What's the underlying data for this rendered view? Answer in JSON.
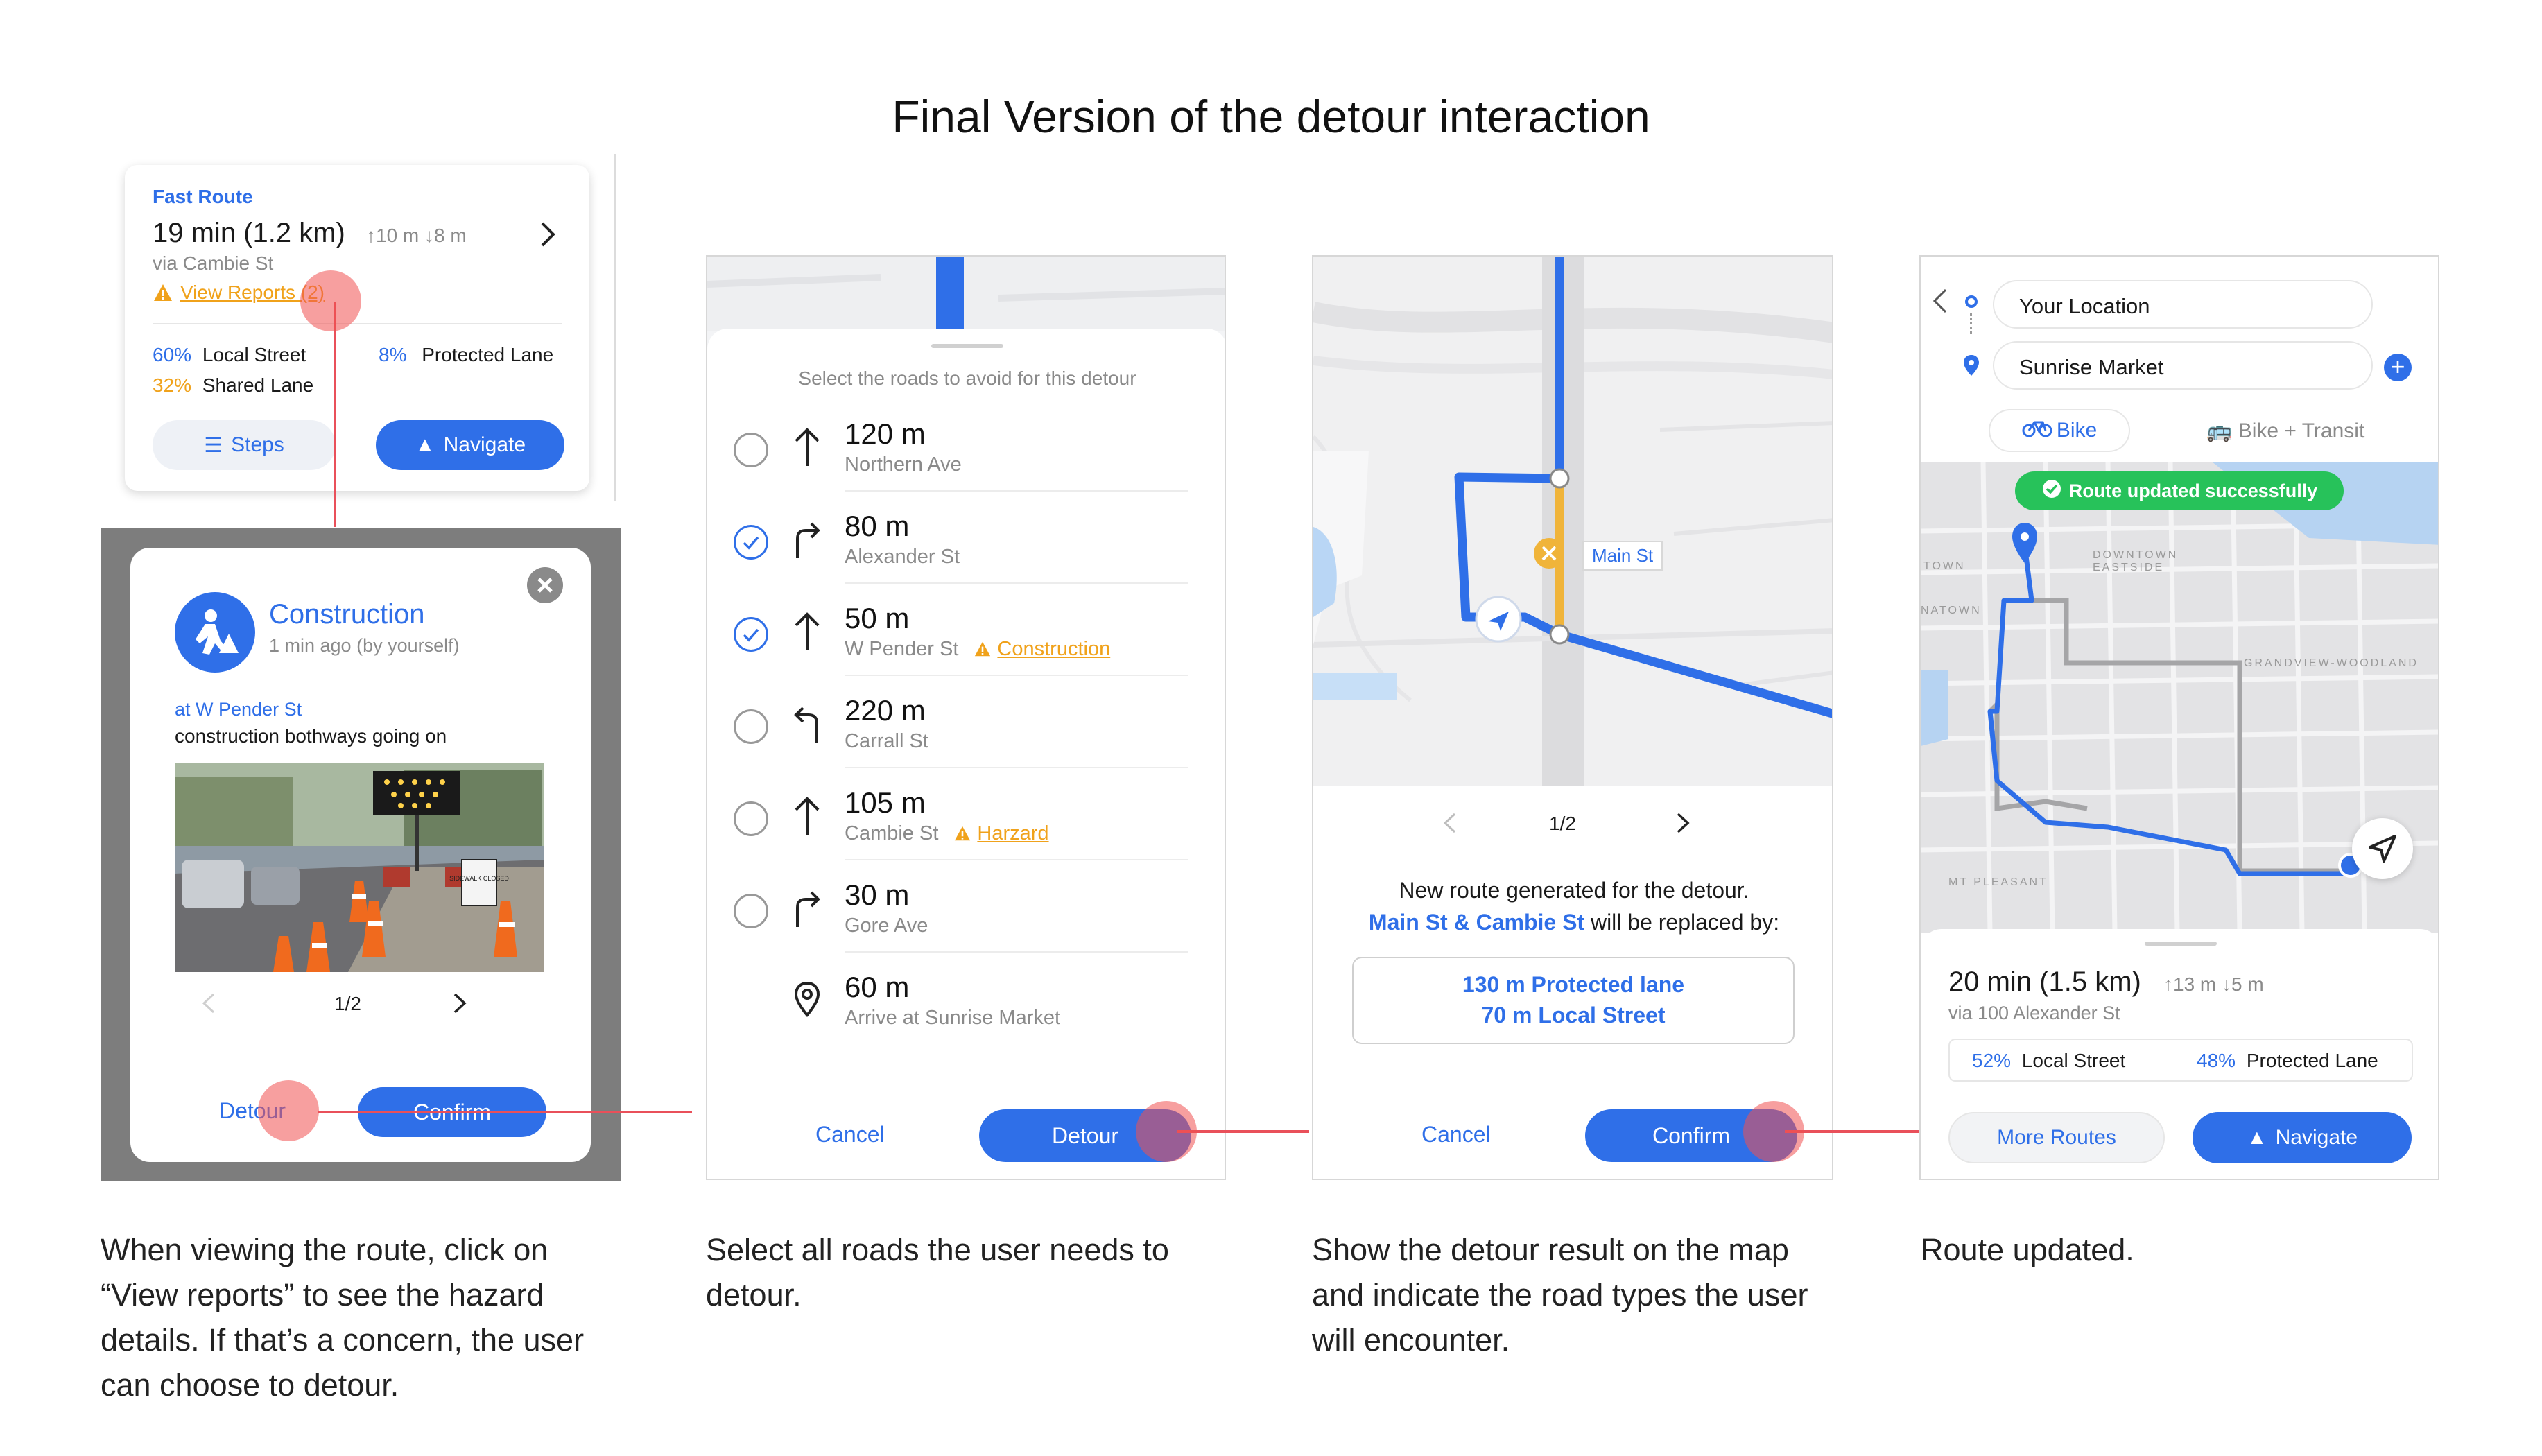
{
  "title": "Final Version of the detour interaction",
  "captions": [
    "When viewing the route, click on “View reports” to see the hazard details. If that’s a concern, the user can choose to detour.",
    "Select all roads the user needs to detour.",
    "Show the detour result on the map and indicate the road types the user will encounter.",
    "Route updated."
  ],
  "screen1": {
    "route_card": {
      "label": "Fast Route",
      "time": "19 min (1.2 km)",
      "elevation": "↑10 m ↓8 m",
      "via": "via Cambie St",
      "reports_link": "View Reports (2)",
      "stats": [
        {
          "pct": "60%",
          "label": "Local Street"
        },
        {
          "pct": "8%",
          "label": "Protected Lane"
        },
        {
          "pct": "32%",
          "label": "Shared Lane"
        }
      ],
      "steps_label": "Steps",
      "navigate_label": "Navigate"
    },
    "hazard_popup": {
      "type": "Construction",
      "meta": "1 min ago (by yourself)",
      "location": "at W Pender St",
      "description": "construction bothways going on",
      "photo_sign": "SIDEWALK CLOSED",
      "pager": "1/2",
      "detour_label": "Detour",
      "confirm_label": "Confirm"
    }
  },
  "screen2": {
    "header": "Select the roads to avoid for this detour",
    "rows": [
      {
        "icon": "straight-arrow-icon",
        "distance": "120 m",
        "street": "Northern Ave",
        "checked": false,
        "warning": ""
      },
      {
        "icon": "turn-right-icon",
        "distance": "80 m",
        "street": "Alexander St",
        "checked": true,
        "warning": ""
      },
      {
        "icon": "straight-arrow-icon",
        "distance": "50 m",
        "street": "W Pender St",
        "checked": true,
        "warning": "Construction"
      },
      {
        "icon": "turn-left-icon",
        "distance": "220 m",
        "street": "Carrall St",
        "checked": false,
        "warning": ""
      },
      {
        "icon": "straight-arrow-icon",
        "distance": "105 m",
        "street": "Cambie St",
        "checked": false,
        "warning": "Harzard"
      },
      {
        "icon": "turn-right-icon",
        "distance": "30 m",
        "street": "Gore Ave",
        "checked": false,
        "warning": ""
      },
      {
        "icon": "destination-pin-icon",
        "distance": "60 m",
        "street": "Arrive at Sunrise Market",
        "checked": null,
        "warning": ""
      }
    ],
    "cancel_label": "Cancel",
    "detour_label": "Detour"
  },
  "screen3": {
    "map_label": "Main St",
    "pager": "1/2",
    "line1": "New route generated for the detour.",
    "line2_bold": "Main St & Cambie St",
    "line2_rest": " will be replaced by:",
    "replace_1": "130 m Protected lane",
    "replace_2": "70 m Local Street",
    "cancel_label": "Cancel",
    "confirm_label": "Confirm"
  },
  "screen4": {
    "origin": "Your Location",
    "destination": "Sunrise Market",
    "mode_bike": "Bike",
    "mode_transit": "Bike + Transit",
    "toast": "Route updated successfully",
    "map_labels": [
      "DOWNTOWN EASTSIDE",
      "TOWN",
      "NATOWN",
      "GRANDVIEW-WOODLAND",
      "MT PLEASANT"
    ],
    "time": "20 min (1.5 km)",
    "elevation": "↑13 m ↓5 m",
    "via": "via 100 Alexander St",
    "stats": [
      {
        "pct": "52%",
        "label": "Local Street"
      },
      {
        "pct": "48%",
        "label": "Protected Lane"
      }
    ],
    "more_routes_label": "More Routes",
    "navigate_label": "Navigate"
  },
  "colors": {
    "accent": "#2f6fe8",
    "warning": "#f0a21b",
    "success": "#27c25a",
    "hotspot": "#f05050",
    "connector": "#e9505a"
  }
}
